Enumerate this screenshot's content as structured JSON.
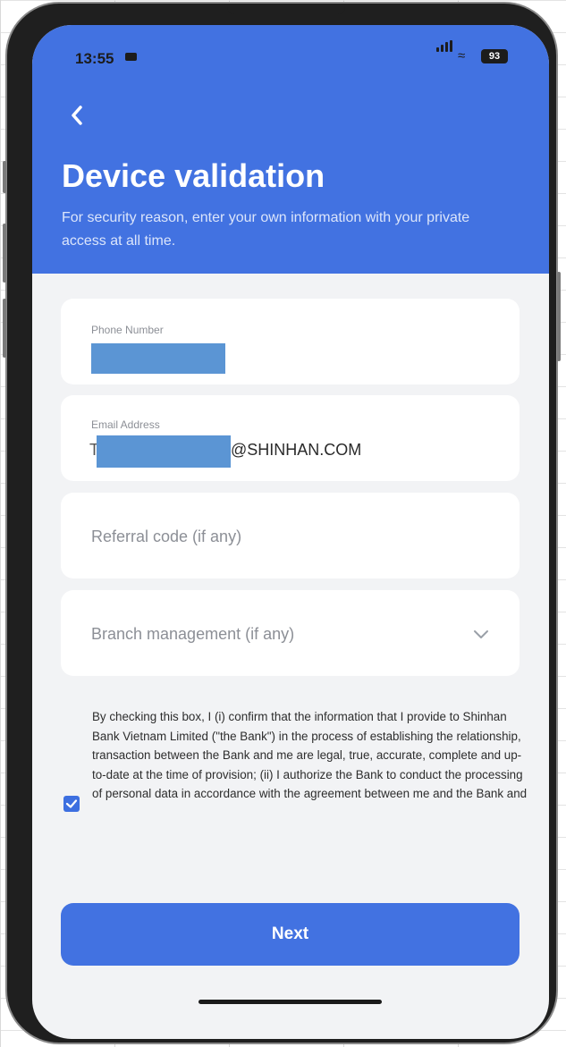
{
  "status_bar": {
    "time": "13:55",
    "battery": "93"
  },
  "header": {
    "title": "Device validation",
    "subtitle": "For security reason, enter your own information with your private access at all time."
  },
  "form": {
    "phone": {
      "label": "Phone Number"
    },
    "email": {
      "label": "Email Address",
      "prefix": "T",
      "value_suffix": "@SHINHAN.COM"
    },
    "referral": {
      "placeholder": "Referral code (if any)"
    },
    "branch": {
      "placeholder": "Branch management (if any)"
    }
  },
  "consent": {
    "checked": true,
    "text": "By checking this box, I (i) confirm that the information that I provide to Shinhan Bank Vietnam Limited (\"the Bank\") in the process of establishing the relationship, transaction between the Bank and me are legal, true, accurate, complete and up-to-date at the time of provision; (ii) I authorize the Bank to conduct the processing of personal data in accordance with the agreement between me and the Bank and"
  },
  "actions": {
    "next_label": "Next"
  },
  "colors": {
    "primary": "#4272e1",
    "background": "#f2f3f5",
    "redaction": "#5b95d4"
  }
}
